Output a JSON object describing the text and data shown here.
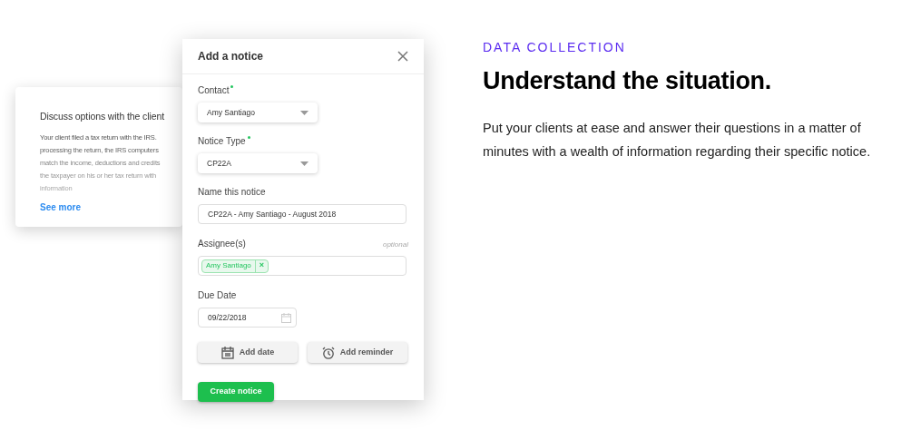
{
  "background_card": {
    "title": "Discuss options with the client",
    "lines": [
      "Your client filed a tax return with the IRS.",
      "processing the return, the IRS computers",
      "match the income, deductions and credits",
      "the taxpayer on his or her tax return with",
      "information"
    ],
    "link": "See more"
  },
  "dialog": {
    "title": "Add a notice",
    "fields": [
      {
        "kind": "select",
        "label": "Contact",
        "required": true,
        "value": "Amy Santiago"
      },
      {
        "kind": "select",
        "label": "Notice Type",
        "required": true,
        "value": "CP22A"
      },
      {
        "kind": "text",
        "label": "Name this notice",
        "value": "CP22A - Amy Santiago - August 2018"
      },
      {
        "kind": "tags",
        "label": "Assignee(s)",
        "hint": "optional",
        "tags": [
          {
            "label": "Amy Santiago",
            "remove": "×"
          }
        ]
      },
      {
        "kind": "date",
        "label": "Due Date",
        "value": "09/22/2018"
      }
    ],
    "actions": [
      {
        "kind": "calendar",
        "label": "Add date"
      },
      {
        "kind": "clock",
        "label": "Add reminder"
      }
    ],
    "submit": "Create notice"
  },
  "section": {
    "eyebrow": "DATA COLLECTION",
    "heading": "Understand the situation.",
    "body": "Put your clients at ease and answer their questions in a matter of minutes with a wealth of information regarding their specific notice."
  }
}
